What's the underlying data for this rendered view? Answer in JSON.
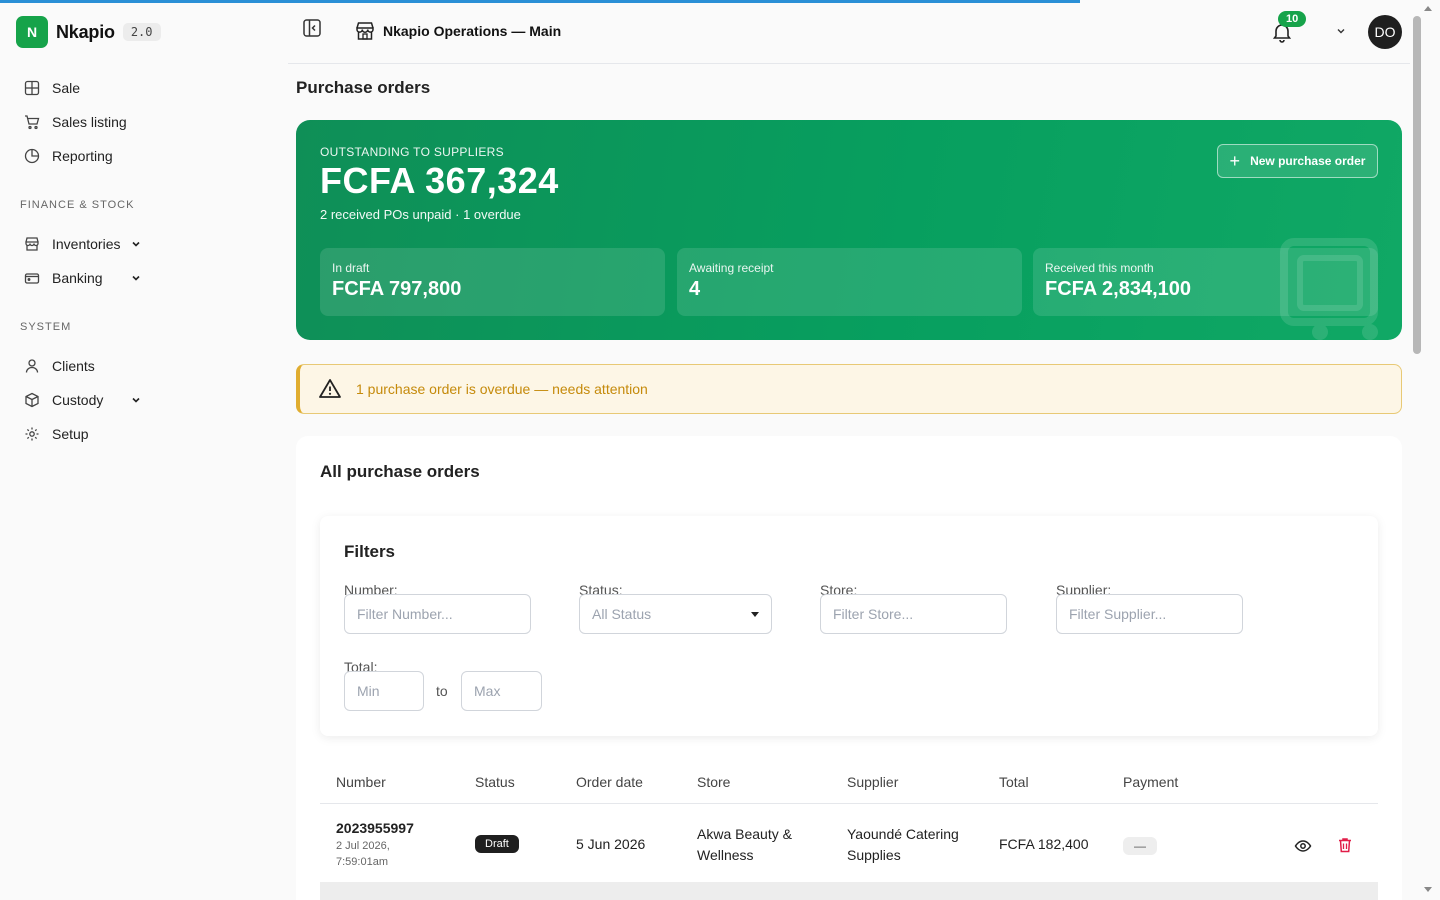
{
  "brand": {
    "logo_letter": "N",
    "name": "Nkapio",
    "version": "2.0"
  },
  "sidebar": {
    "items": [
      {
        "label": "Sale",
        "icon": "pos-grid-icon"
      },
      {
        "label": "Sales listing",
        "icon": "cart-icon"
      },
      {
        "label": "Reporting",
        "icon": "pie-chart-icon"
      }
    ],
    "finance_section": "FINANCE & STOCK",
    "finance_items": [
      {
        "label": "Inventories",
        "icon": "store-icon",
        "expandable": true
      },
      {
        "label": "Banking",
        "icon": "wallet-icon",
        "expandable": true
      }
    ],
    "system_section": "SYSTEM",
    "system_items": [
      {
        "label": "Clients",
        "icon": "user-icon"
      },
      {
        "label": "Custody",
        "icon": "box-icon",
        "expandable": true
      },
      {
        "label": "Setup",
        "icon": "gear-icon"
      }
    ]
  },
  "header": {
    "store_name": "Nkapio Operations — Main",
    "notification_count": "10",
    "avatar_initials": "DO"
  },
  "page": {
    "title": "Purchase orders"
  },
  "hero": {
    "eyebrow": "OUTSTANDING TO SUPPLIERS",
    "amount": "FCFA 367,324",
    "subtitle": "2 received POs unpaid · 1 overdue",
    "new_button": "New purchase order",
    "stats": [
      {
        "label": "In draft",
        "value": "FCFA 797,800"
      },
      {
        "label": "Awaiting receipt",
        "value": "4"
      },
      {
        "label": "Received this month",
        "value": "FCFA 2,834,100"
      }
    ]
  },
  "alert": {
    "text": "1 purchase order is overdue — needs attention"
  },
  "list": {
    "title": "All purchase orders",
    "filters": {
      "title": "Filters",
      "number_label": "Number:",
      "number_placeholder": "Filter Number...",
      "status_label": "Status:",
      "status_value": "All Status",
      "store_label": "Store:",
      "store_placeholder": "Filter Store...",
      "supplier_label": "Supplier:",
      "supplier_placeholder": "Filter Supplier...",
      "total_label": "Total:",
      "min_placeholder": "Min",
      "to_label": "to",
      "max_placeholder": "Max"
    },
    "columns": [
      "Number",
      "Status",
      "Order date",
      "Store",
      "Supplier",
      "Total",
      "Payment"
    ],
    "rows": [
      {
        "number": "2023955997",
        "created_date": "2 Jul 2026,",
        "created_time": "7:59:01am",
        "status": "Draft",
        "order_date": "5 Jun 2026",
        "store": "Akwa Beauty & Wellness",
        "supplier": "Yaoundé Catering Supplies",
        "total": "FCFA 182,400",
        "payment": "—"
      }
    ]
  },
  "colors": {
    "brand_green": "#16a34a",
    "hero_green": "#079f5f",
    "alert_text": "#c58a0b",
    "delete_red": "#e11d48"
  }
}
